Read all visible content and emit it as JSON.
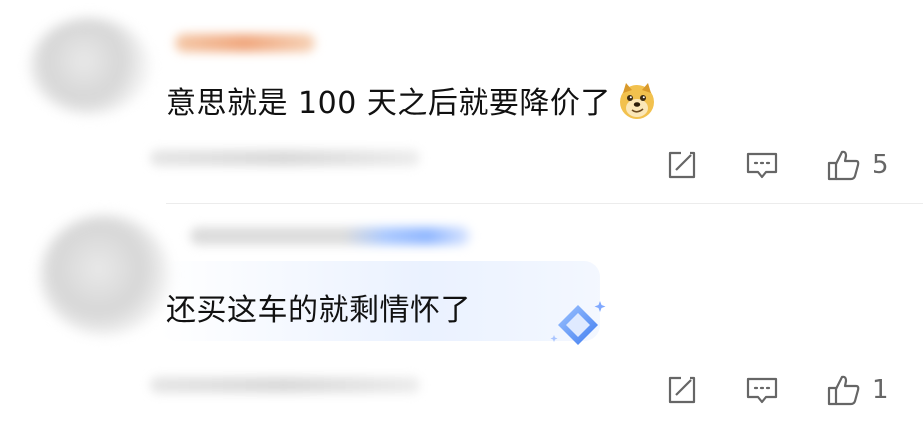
{
  "comments": [
    {
      "text": "意思就是 100 天之后就要降价了",
      "emoji": "doge-emoji",
      "like_count": "5"
    },
    {
      "text": "还买这车的就剩情怀了",
      "decoration": "diamond-badge-icon",
      "like_count": "1"
    }
  ],
  "icons": {
    "share": "share-icon",
    "reply": "comment-icon",
    "like": "thumbs-up-icon"
  },
  "colors": {
    "text": "#111111",
    "icon": "#666666",
    "accent_blue": "#5b8dff"
  }
}
